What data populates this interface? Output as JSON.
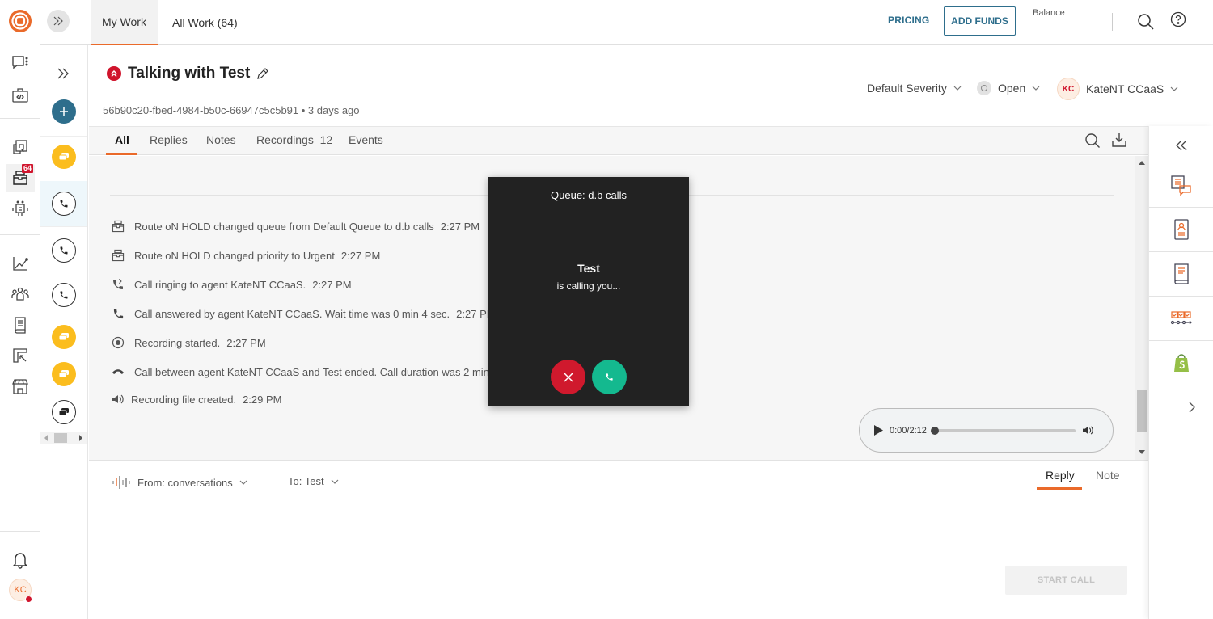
{
  "brand": {
    "accent": "#ea6a2a",
    "primary": "#2e6e8c",
    "danger": "#d0142c",
    "success": "#14b98f"
  },
  "topbar": {
    "tabs": [
      {
        "label": "My Work",
        "active": true
      },
      {
        "label": "All Work (64)",
        "active": false
      }
    ],
    "pricing_label": "PRICING",
    "add_funds_label": "ADD FUNDS",
    "balance_label": "Balance"
  },
  "rail": {
    "items": [
      {
        "icon": "chat-menu-icon"
      },
      {
        "icon": "developer-briefcase-icon"
      },
      {
        "icon": "copy-chat-icon"
      },
      {
        "icon": "inbox-icon",
        "badge": "64",
        "active": true
      },
      {
        "icon": "bot-icon"
      },
      {
        "icon": "analytics-icon"
      },
      {
        "icon": "team-icon"
      },
      {
        "icon": "book-icon"
      },
      {
        "icon": "layout-cursor-icon"
      },
      {
        "icon": "store-icon"
      }
    ],
    "notifications_icon": "bell-icon",
    "avatar_initials": "KC"
  },
  "conversations": [
    {
      "type": "chat"
    },
    {
      "type": "call",
      "selected": true
    },
    {
      "type": "call"
    },
    {
      "type": "call"
    },
    {
      "type": "chat"
    },
    {
      "type": "chat"
    },
    {
      "type": "chat-outline"
    }
  ],
  "header": {
    "title": "Talking with Test",
    "subtitle": "56b90c20-fbed-4984-b50c-66947c5c5b91 • 3 days ago",
    "severity": "Default Severity",
    "status": "Open",
    "assignee_initials": "KC",
    "assignee": "KateNT CCaaS"
  },
  "content_tabs": [
    {
      "label": "All",
      "active": true
    },
    {
      "label": "Replies"
    },
    {
      "label": "Notes"
    },
    {
      "label": "Recordings",
      "count": "12"
    },
    {
      "label": "Events"
    }
  ],
  "events": [
    {
      "icon": "inbox-icon",
      "text": "Route oN HOLD changed queue from Default Queue to d.b calls",
      "time": "2:27 PM"
    },
    {
      "icon": "inbox-icon",
      "text": "Route oN HOLD changed priority to Urgent",
      "time": "2:27 PM"
    },
    {
      "icon": "phone-ringing-icon",
      "text": "Call ringing to agent KateNT CCaaS.",
      "time": "2:27 PM"
    },
    {
      "icon": "phone-icon",
      "text": "Call answered by agent KateNT CCaaS. Wait time was 0 min 4 sec.",
      "time": "2:27 PM"
    },
    {
      "icon": "record-icon",
      "text": "Recording started.",
      "time": "2:27 PM"
    },
    {
      "icon": "hangup-icon",
      "text": "Call between agent KateNT CCaaS and Test ended. Call duration was 2 min",
      "time": ""
    },
    {
      "icon": "speaker-icon",
      "text": "Recording file created.",
      "time": "2:29 PM"
    }
  ],
  "audio": {
    "time": "0:00/2:12",
    "progress": 0
  },
  "incoming_call": {
    "queue": "Queue: d.b calls",
    "caller": "Test",
    "message": "is calling you..."
  },
  "composer": {
    "from": "From: conversations",
    "to": "To: Test",
    "tabs": [
      {
        "label": "Reply",
        "active": true
      },
      {
        "label": "Note"
      }
    ],
    "start_call_label": "START CALL"
  },
  "right_panel": {
    "items": [
      "conversation-notes-icon",
      "contact-card-icon",
      "knowledge-book-icon",
      "journey-flow-icon",
      "shopify-icon"
    ]
  }
}
